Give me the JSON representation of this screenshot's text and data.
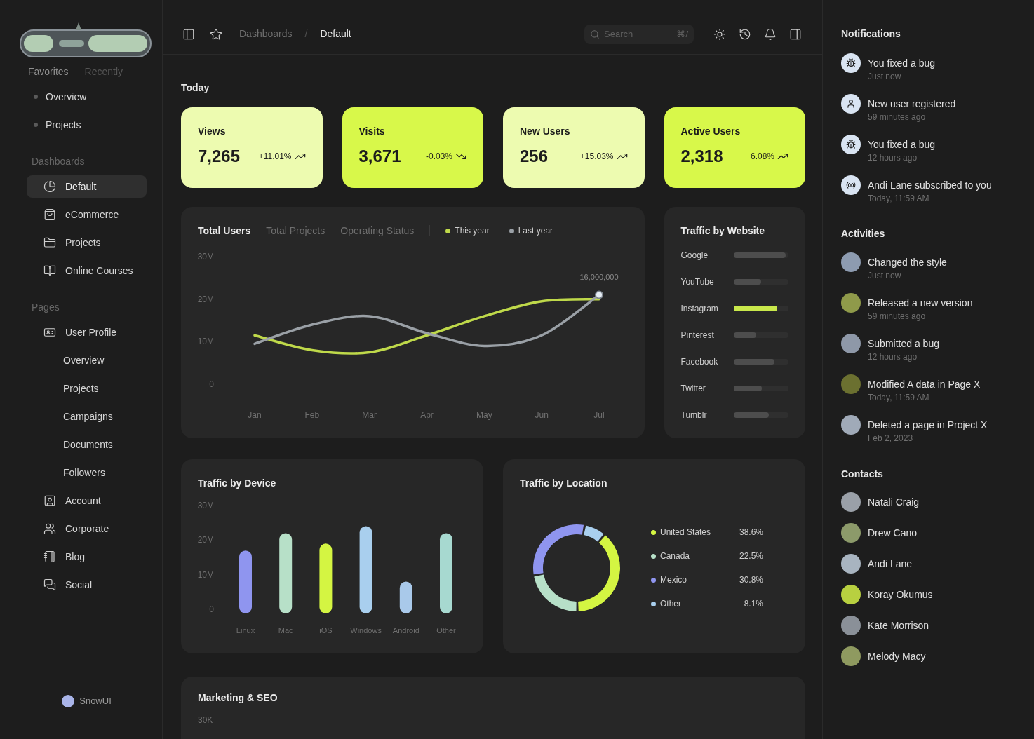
{
  "sidebar": {
    "tabs": [
      {
        "label": "Favorites",
        "selected": true
      },
      {
        "label": "Recently",
        "selected": false
      }
    ],
    "favorites": [
      "Overview",
      "Projects"
    ],
    "dashboards": {
      "title": "Dashboards",
      "items": [
        {
          "label": "Default",
          "selected": true
        },
        {
          "label": "eCommerce",
          "selected": false
        },
        {
          "label": "Projects",
          "selected": false
        },
        {
          "label": "Online Courses",
          "selected": false
        }
      ]
    },
    "pages": {
      "title": "Pages",
      "items": [
        {
          "label": "User Profile",
          "children": [
            {
              "label": "Overview"
            },
            {
              "label": "Projects"
            },
            {
              "label": "Campaigns"
            },
            {
              "label": "Documents"
            },
            {
              "label": "Followers"
            }
          ]
        },
        {
          "label": "Account"
        },
        {
          "label": "Corporate"
        },
        {
          "label": "Blog"
        },
        {
          "label": "Social"
        }
      ]
    },
    "brand": {
      "name": "SnowUI"
    }
  },
  "header": {
    "breadcrumb": [
      {
        "label": "Dashboards",
        "current": false
      },
      {
        "label": "Default",
        "current": true
      }
    ],
    "separator": "/",
    "search": {
      "placeholder": "Search",
      "shortcut": "⌘/"
    }
  },
  "page_title": "Today",
  "stats": [
    {
      "label": "Views",
      "value": "7,265",
      "change": "+11.01%",
      "increase": true,
      "color": "#edfbb0"
    },
    {
      "label": "Visits",
      "value": "3,671",
      "change": "-0.03%",
      "increase": false,
      "color": "#d8f84a"
    },
    {
      "label": "New Users",
      "value": "256",
      "change": "+15.03%",
      "increase": true,
      "color": "#edfbb0"
    },
    {
      "label": "Active Users",
      "value": "2,318",
      "change": "+6.08%",
      "increase": true,
      "color": "#d8f84a"
    }
  ],
  "overview_chart": {
    "tabs": [
      {
        "label": "Total Users",
        "selected": true
      },
      {
        "label": "Total Projects",
        "selected": false
      },
      {
        "label": "Operating Status",
        "selected": false
      }
    ],
    "chart_data": {
      "type": "line",
      "categories": [
        "Jan",
        "Feb",
        "Mar",
        "Apr",
        "May",
        "Jun",
        "Jul"
      ],
      "series": [
        {
          "name": "This year",
          "color": "#bfd94a",
          "values": [
            11.5,
            8,
            7.5,
            11.5,
            16,
            19.5,
            20
          ]
        },
        {
          "name": "Last year",
          "color": "#9aa0a6",
          "values": [
            9.5,
            14,
            16,
            12,
            9,
            11.5,
            21
          ]
        }
      ],
      "ylim": [
        0,
        30
      ],
      "yticks": [
        {
          "value": 0,
          "label": "0"
        },
        {
          "value": 10,
          "label": "10M"
        },
        {
          "value": 20,
          "label": "20M"
        },
        {
          "value": 30,
          "label": "30M"
        }
      ],
      "annotations": [
        "16,000,000"
      ]
    }
  },
  "traffic_by_website": {
    "title": "Traffic by Website",
    "sites": [
      {
        "name": "Google",
        "level": 0.95,
        "selected": false
      },
      {
        "name": "YouTube",
        "level": 0.5,
        "selected": false
      },
      {
        "name": "Instagram",
        "level": 0.8,
        "selected": true
      },
      {
        "name": "Pinterest",
        "level": 0.42,
        "selected": false
      },
      {
        "name": "Facebook",
        "level": 0.75,
        "selected": false
      },
      {
        "name": "Twitter",
        "level": 0.52,
        "selected": false
      },
      {
        "name": "Tumblr",
        "level": 0.64,
        "selected": false
      }
    ]
  },
  "traffic_by_device": {
    "title": "Traffic by Device",
    "chart_data": {
      "type": "bar",
      "categories": [
        "Linux",
        "Mac",
        "iOS",
        "Windows",
        "Android",
        "Other"
      ],
      "values": [
        17,
        22,
        19,
        24,
        8,
        22
      ],
      "colors": [
        "#8f95ef",
        "#b7e0c8",
        "#d4f542",
        "#a9cfee",
        "#a9c9ea",
        "#a7d9d0"
      ],
      "ylim": [
        0,
        30
      ],
      "yticks": [
        {
          "value": 0,
          "label": "0"
        },
        {
          "value": 10,
          "label": "10M"
        },
        {
          "value": 20,
          "label": "20M"
        },
        {
          "value": 30,
          "label": "30M"
        }
      ]
    }
  },
  "traffic_by_location": {
    "title": "Traffic by Location",
    "chart_data": {
      "type": "donut",
      "categories": [
        "United States",
        "Canada",
        "Mexico",
        "Other"
      ],
      "values": [
        38.6,
        22.5,
        30.8,
        8.1
      ],
      "colors": [
        "#d4f542",
        "#b7e0c8",
        "#8f95ef",
        "#a9cfee"
      ],
      "value_labels": [
        "38.6%",
        "22.5%",
        "30.8%",
        "8.1%"
      ],
      "legend": "right"
    }
  },
  "marketing": {
    "title": "Marketing & SEO",
    "axis_labels": [
      "30K"
    ]
  },
  "notifications": {
    "title": "Notifications",
    "items": [
      {
        "kind": "bug",
        "title": "You fixed a bug",
        "time": "Just now"
      },
      {
        "kind": "user",
        "title": "New user registered",
        "time": "59 minutes ago"
      },
      {
        "kind": "bug",
        "title": "You fixed a bug",
        "time": "12 hours ago"
      },
      {
        "kind": "broadcast",
        "title": "Andi Lane subscribed to you",
        "time": "Today, 11:59 AM"
      }
    ]
  },
  "activities": {
    "title": "Activities",
    "items": [
      {
        "title": "Changed the style",
        "time": "Just now",
        "color": "#8d9bb0"
      },
      {
        "title": "Released a new version",
        "time": "59 minutes ago",
        "color": "#8f9a4a"
      },
      {
        "title": "Submitted a bug",
        "time": "12 hours ago",
        "color": "#8e98a8"
      },
      {
        "title": "Modified A data in Page X",
        "time": "Today, 11:59 AM",
        "color": "#6b7030"
      },
      {
        "title": "Deleted a page in Project X",
        "time": "Feb 2, 2023",
        "color": "#a0aab8"
      }
    ]
  },
  "contacts": {
    "title": "Contacts",
    "items": [
      {
        "name": "Natali Craig",
        "color": "#9aa0a8"
      },
      {
        "name": "Drew Cano",
        "color": "#8c9a6a"
      },
      {
        "name": "Andi Lane",
        "color": "#a8b4c0"
      },
      {
        "name": "Koray Okumus",
        "color": "#b8d040"
      },
      {
        "name": "Kate Morrison",
        "color": "#8a9098"
      },
      {
        "name": "Melody Macy",
        "color": "#8f9a60"
      }
    ]
  }
}
